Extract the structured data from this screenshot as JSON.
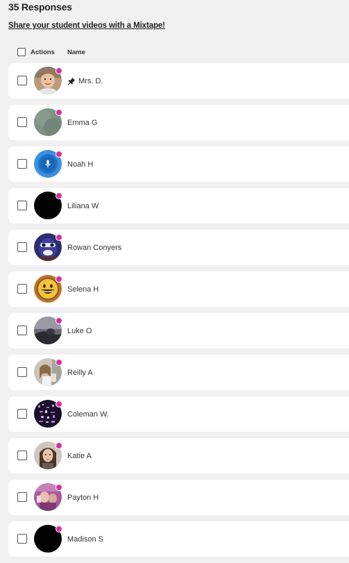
{
  "header": {
    "title": "35 Responses",
    "mixtape_link": "Share your student videos with a Mixtape!"
  },
  "table": {
    "col_actions": "Actions",
    "col_name": "Name"
  },
  "colors": {
    "status_dot": "#d6329f",
    "row_bg": "#ffffff",
    "page_bg": "#f0f0f0"
  },
  "rows": [
    {
      "name": "Mrs. D.",
      "pinned": true,
      "avatar": "photo-woman-avatar"
    },
    {
      "name": "Emma G",
      "pinned": false,
      "avatar": "gray-green-avatar"
    },
    {
      "name": "Noah H",
      "pinned": false,
      "avatar": "blue-mic-avatar"
    },
    {
      "name": "Liliana W",
      "pinned": false,
      "avatar": "black-avatar"
    },
    {
      "name": "Rowan Conyers",
      "pinned": false,
      "avatar": "costume-avatar"
    },
    {
      "name": "Selena H",
      "pinned": false,
      "avatar": "emoji-avatar"
    },
    {
      "name": "Luke O",
      "pinned": false,
      "avatar": "dark-room-avatar"
    },
    {
      "name": "Reilly A",
      "pinned": false,
      "avatar": "photo-girl-avatar"
    },
    {
      "name": "Coleman W.",
      "pinned": false,
      "avatar": "purple-pattern-avatar"
    },
    {
      "name": "Katie A",
      "pinned": false,
      "avatar": "photo-girl-avatar-2"
    },
    {
      "name": "Payton H",
      "pinned": false,
      "avatar": "purple-photo-avatar"
    },
    {
      "name": "Madison S",
      "pinned": false,
      "avatar": "black-avatar"
    }
  ]
}
